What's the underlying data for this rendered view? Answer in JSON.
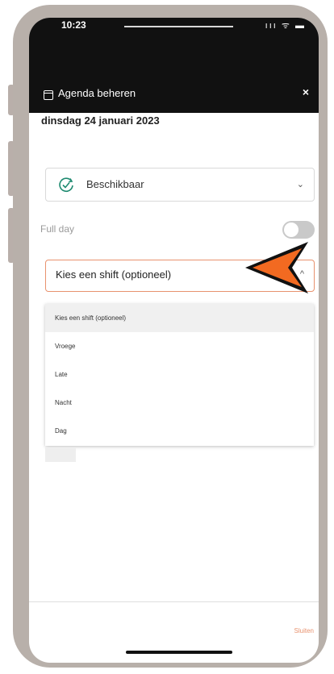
{
  "status_bar": {
    "time": "10:23",
    "icons": "ııı ᯤ ▬"
  },
  "header": {
    "title": "Agenda beheren",
    "close_label": "×"
  },
  "date": "dinsdag 24 januari 2023",
  "availability": {
    "value": "Beschikbaar",
    "icon": "clock-check-icon",
    "chevron": "⌄"
  },
  "full_day": {
    "label": "Full day",
    "on": false
  },
  "shift": {
    "value": "Kies een shift (optioneel)",
    "chevron": "^",
    "options": [
      "Kies een shift (optioneel)",
      "Vroege",
      "Late",
      "Nacht",
      "Dag"
    ],
    "selected_index": 0
  },
  "footer": {
    "close_label": "Sluiten"
  },
  "colors": {
    "accent": "#e8926e",
    "header_bg": "#111111",
    "annotation_arrow": "#f26a21"
  }
}
